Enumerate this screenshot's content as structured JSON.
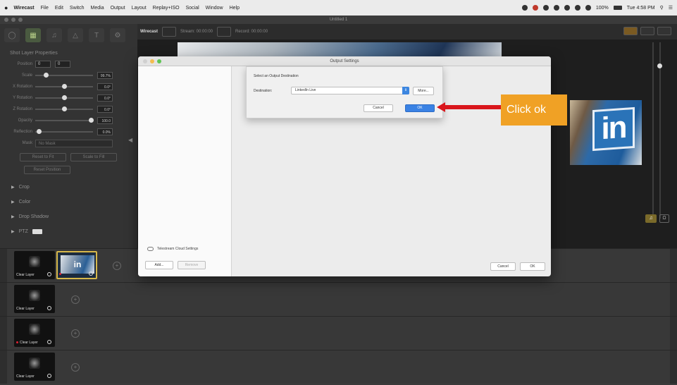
{
  "menubar": {
    "apple": "",
    "app": "Wirecast",
    "items": [
      "File",
      "Edit",
      "Switch",
      "Media",
      "Output",
      "Layout",
      "Replay+ISO",
      "Social",
      "Window",
      "Help"
    ],
    "battery": "100%",
    "clock": "Tue 4:58 PM"
  },
  "window": {
    "title": "Untitled 1"
  },
  "left_panel": {
    "title": "Shot Layer Properties",
    "position_label": "Position",
    "position_x": "0",
    "position_y": "0",
    "scale_label": "Scale",
    "scale_value": "99.7%",
    "x_rotation_label": "X Rotation",
    "x_rotation_value": "0.0°",
    "y_rotation_label": "Y Rotation",
    "y_rotation_value": "0.0°",
    "z_rotation_label": "Z Rotation",
    "z_rotation_value": "0.0°",
    "opacity_label": "Opacity",
    "opacity_value": "100.0",
    "reflection_label": "Reflection",
    "reflection_value": "0.0%",
    "mask_label": "Mask",
    "mask_value": "No Mask",
    "btn_reset": "Reset to Fit",
    "btn_fill": "Scale to Fill",
    "btn_position": "Reset Position",
    "sections": [
      "Crop",
      "Color",
      "Drop Shadow",
      "PTZ"
    ]
  },
  "main_toolbar": {
    "logo": "Wirecast",
    "stream": "Stream: 00:00:00",
    "record": "Record: 00:00:00"
  },
  "dialog": {
    "title": "Output Settings",
    "cloud": "Telestream Cloud Settings",
    "add": "Add...",
    "remove": "Remove",
    "cancel": "Cancel",
    "ok": "OK"
  },
  "sheet": {
    "heading": "Select an Output Destination",
    "dest_label": "Destination:",
    "dest_value": "LinkedIn Live",
    "more": "More...",
    "cancel": "Cancel",
    "ok": "OK"
  },
  "annotation": {
    "text": "Click ok",
    "color": "#f0a125",
    "arrow_color": "#d9161c"
  },
  "layers": {
    "shot_label": "Clear Layer",
    "li_text": "in"
  },
  "preview": {
    "li_text": "in"
  }
}
